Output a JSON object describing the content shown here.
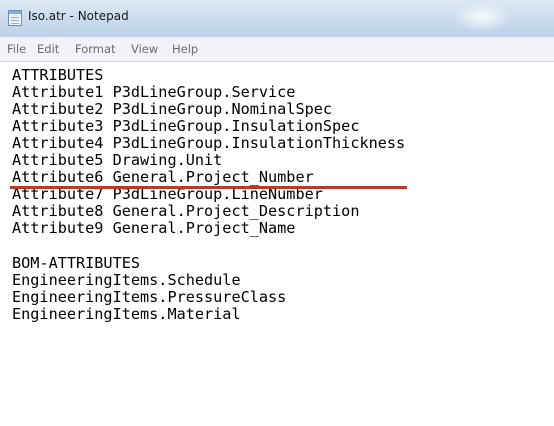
{
  "window": {
    "title": "Iso.atr - Notepad"
  },
  "menu": {
    "items": [
      "File",
      "Edit",
      "Format",
      "View",
      "Help"
    ]
  },
  "editor": {
    "attributes_lines": [
      "ATTRIBUTES",
      "Attribute1 P3dLineGroup.Service",
      "Attribute2 P3dLineGroup.NominalSpec",
      "Attribute3 P3dLineGroup.InsulationSpec",
      "Attribute4 P3dLineGroup.InsulationThickness",
      "Attribute5 Drawing.Unit",
      "Attribute6 General.Project_Number",
      "Attribute7 P3dLineGroup.LineNumber",
      "Attribute8 General.Project_Description",
      "Attribute9 General.Project_Name"
    ],
    "bom_lines": [
      "BOM-ATTRIBUTES",
      "EngineeringItems.Schedule",
      "EngineeringItems.PressureClass",
      "EngineeringItems.Material"
    ]
  },
  "colors": {
    "annotation": "#b83a2e",
    "titlebar": "#cdddef",
    "menubar": "#f1f3f8"
  }
}
